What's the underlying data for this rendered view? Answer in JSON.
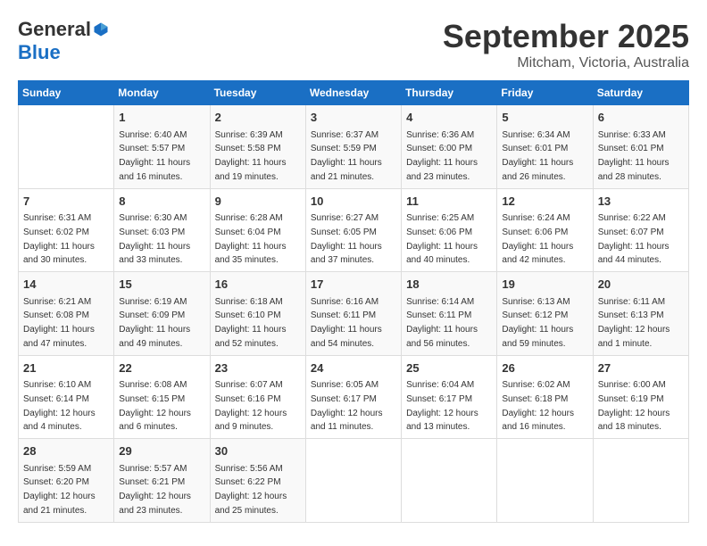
{
  "header": {
    "logo_general": "General",
    "logo_blue": "Blue",
    "month": "September 2025",
    "location": "Mitcham, Victoria, Australia"
  },
  "days_of_week": [
    "Sunday",
    "Monday",
    "Tuesday",
    "Wednesday",
    "Thursday",
    "Friday",
    "Saturday"
  ],
  "weeks": [
    [
      {
        "day": "",
        "sunrise": "",
        "sunset": "",
        "daylight": ""
      },
      {
        "day": "1",
        "sunrise": "Sunrise: 6:40 AM",
        "sunset": "Sunset: 5:57 PM",
        "daylight": "Daylight: 11 hours and 16 minutes."
      },
      {
        "day": "2",
        "sunrise": "Sunrise: 6:39 AM",
        "sunset": "Sunset: 5:58 PM",
        "daylight": "Daylight: 11 hours and 19 minutes."
      },
      {
        "day": "3",
        "sunrise": "Sunrise: 6:37 AM",
        "sunset": "Sunset: 5:59 PM",
        "daylight": "Daylight: 11 hours and 21 minutes."
      },
      {
        "day": "4",
        "sunrise": "Sunrise: 6:36 AM",
        "sunset": "Sunset: 6:00 PM",
        "daylight": "Daylight: 11 hours and 23 minutes."
      },
      {
        "day": "5",
        "sunrise": "Sunrise: 6:34 AM",
        "sunset": "Sunset: 6:01 PM",
        "daylight": "Daylight: 11 hours and 26 minutes."
      },
      {
        "day": "6",
        "sunrise": "Sunrise: 6:33 AM",
        "sunset": "Sunset: 6:01 PM",
        "daylight": "Daylight: 11 hours and 28 minutes."
      }
    ],
    [
      {
        "day": "7",
        "sunrise": "Sunrise: 6:31 AM",
        "sunset": "Sunset: 6:02 PM",
        "daylight": "Daylight: 11 hours and 30 minutes."
      },
      {
        "day": "8",
        "sunrise": "Sunrise: 6:30 AM",
        "sunset": "Sunset: 6:03 PM",
        "daylight": "Daylight: 11 hours and 33 minutes."
      },
      {
        "day": "9",
        "sunrise": "Sunrise: 6:28 AM",
        "sunset": "Sunset: 6:04 PM",
        "daylight": "Daylight: 11 hours and 35 minutes."
      },
      {
        "day": "10",
        "sunrise": "Sunrise: 6:27 AM",
        "sunset": "Sunset: 6:05 PM",
        "daylight": "Daylight: 11 hours and 37 minutes."
      },
      {
        "day": "11",
        "sunrise": "Sunrise: 6:25 AM",
        "sunset": "Sunset: 6:06 PM",
        "daylight": "Daylight: 11 hours and 40 minutes."
      },
      {
        "day": "12",
        "sunrise": "Sunrise: 6:24 AM",
        "sunset": "Sunset: 6:06 PM",
        "daylight": "Daylight: 11 hours and 42 minutes."
      },
      {
        "day": "13",
        "sunrise": "Sunrise: 6:22 AM",
        "sunset": "Sunset: 6:07 PM",
        "daylight": "Daylight: 11 hours and 44 minutes."
      }
    ],
    [
      {
        "day": "14",
        "sunrise": "Sunrise: 6:21 AM",
        "sunset": "Sunset: 6:08 PM",
        "daylight": "Daylight: 11 hours and 47 minutes."
      },
      {
        "day": "15",
        "sunrise": "Sunrise: 6:19 AM",
        "sunset": "Sunset: 6:09 PM",
        "daylight": "Daylight: 11 hours and 49 minutes."
      },
      {
        "day": "16",
        "sunrise": "Sunrise: 6:18 AM",
        "sunset": "Sunset: 6:10 PM",
        "daylight": "Daylight: 11 hours and 52 minutes."
      },
      {
        "day": "17",
        "sunrise": "Sunrise: 6:16 AM",
        "sunset": "Sunset: 6:11 PM",
        "daylight": "Daylight: 11 hours and 54 minutes."
      },
      {
        "day": "18",
        "sunrise": "Sunrise: 6:14 AM",
        "sunset": "Sunset: 6:11 PM",
        "daylight": "Daylight: 11 hours and 56 minutes."
      },
      {
        "day": "19",
        "sunrise": "Sunrise: 6:13 AM",
        "sunset": "Sunset: 6:12 PM",
        "daylight": "Daylight: 11 hours and 59 minutes."
      },
      {
        "day": "20",
        "sunrise": "Sunrise: 6:11 AM",
        "sunset": "Sunset: 6:13 PM",
        "daylight": "Daylight: 12 hours and 1 minute."
      }
    ],
    [
      {
        "day": "21",
        "sunrise": "Sunrise: 6:10 AM",
        "sunset": "Sunset: 6:14 PM",
        "daylight": "Daylight: 12 hours and 4 minutes."
      },
      {
        "day": "22",
        "sunrise": "Sunrise: 6:08 AM",
        "sunset": "Sunset: 6:15 PM",
        "daylight": "Daylight: 12 hours and 6 minutes."
      },
      {
        "day": "23",
        "sunrise": "Sunrise: 6:07 AM",
        "sunset": "Sunset: 6:16 PM",
        "daylight": "Daylight: 12 hours and 9 minutes."
      },
      {
        "day": "24",
        "sunrise": "Sunrise: 6:05 AM",
        "sunset": "Sunset: 6:17 PM",
        "daylight": "Daylight: 12 hours and 11 minutes."
      },
      {
        "day": "25",
        "sunrise": "Sunrise: 6:04 AM",
        "sunset": "Sunset: 6:17 PM",
        "daylight": "Daylight: 12 hours and 13 minutes."
      },
      {
        "day": "26",
        "sunrise": "Sunrise: 6:02 AM",
        "sunset": "Sunset: 6:18 PM",
        "daylight": "Daylight: 12 hours and 16 minutes."
      },
      {
        "day": "27",
        "sunrise": "Sunrise: 6:00 AM",
        "sunset": "Sunset: 6:19 PM",
        "daylight": "Daylight: 12 hours and 18 minutes."
      }
    ],
    [
      {
        "day": "28",
        "sunrise": "Sunrise: 5:59 AM",
        "sunset": "Sunset: 6:20 PM",
        "daylight": "Daylight: 12 hours and 21 minutes."
      },
      {
        "day": "29",
        "sunrise": "Sunrise: 5:57 AM",
        "sunset": "Sunset: 6:21 PM",
        "daylight": "Daylight: 12 hours and 23 minutes."
      },
      {
        "day": "30",
        "sunrise": "Sunrise: 5:56 AM",
        "sunset": "Sunset: 6:22 PM",
        "daylight": "Daylight: 12 hours and 25 minutes."
      },
      {
        "day": "",
        "sunrise": "",
        "sunset": "",
        "daylight": ""
      },
      {
        "day": "",
        "sunrise": "",
        "sunset": "",
        "daylight": ""
      },
      {
        "day": "",
        "sunrise": "",
        "sunset": "",
        "daylight": ""
      },
      {
        "day": "",
        "sunrise": "",
        "sunset": "",
        "daylight": ""
      }
    ]
  ]
}
